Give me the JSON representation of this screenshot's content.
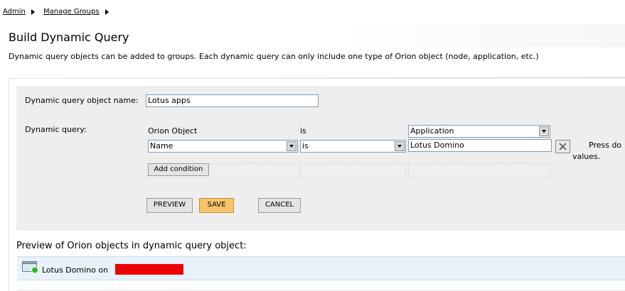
{
  "breadcrumb": [
    "Admin",
    "Manage Groups"
  ],
  "page": {
    "title": "Build Dynamic Query",
    "description": "Dynamic query objects can be added to groups. Each dynamic query can only include one type of Orion object (node, application, etc.)"
  },
  "form": {
    "name_label": "Dynamic query object name:",
    "name_value": "Lotus apps",
    "query_label": "Dynamic query:",
    "orion_object_label": "Orion Object",
    "is_label": "is",
    "object_type_value": "Application",
    "condition": {
      "field": "Name",
      "operator": "is",
      "value": "Lotus Domino"
    },
    "hint_text": "Press do",
    "hint_text2": "values.",
    "add_condition_label": "Add condition"
  },
  "buttons": {
    "preview": "PREVIEW",
    "save": "SAVE",
    "cancel": "CANCEL"
  },
  "preview": {
    "title": "Preview of Orion objects in dynamic query object:",
    "items": [
      {
        "text": "Lotus Domino on",
        "icon": "application-up-icon"
      }
    ]
  },
  "colors": {
    "panel_bg": "#eeeeee",
    "save_button": "#f7c36c",
    "row_highlight": "#e7f2fa",
    "redaction": "#ee0000",
    "status_green": "#2bb52b"
  }
}
